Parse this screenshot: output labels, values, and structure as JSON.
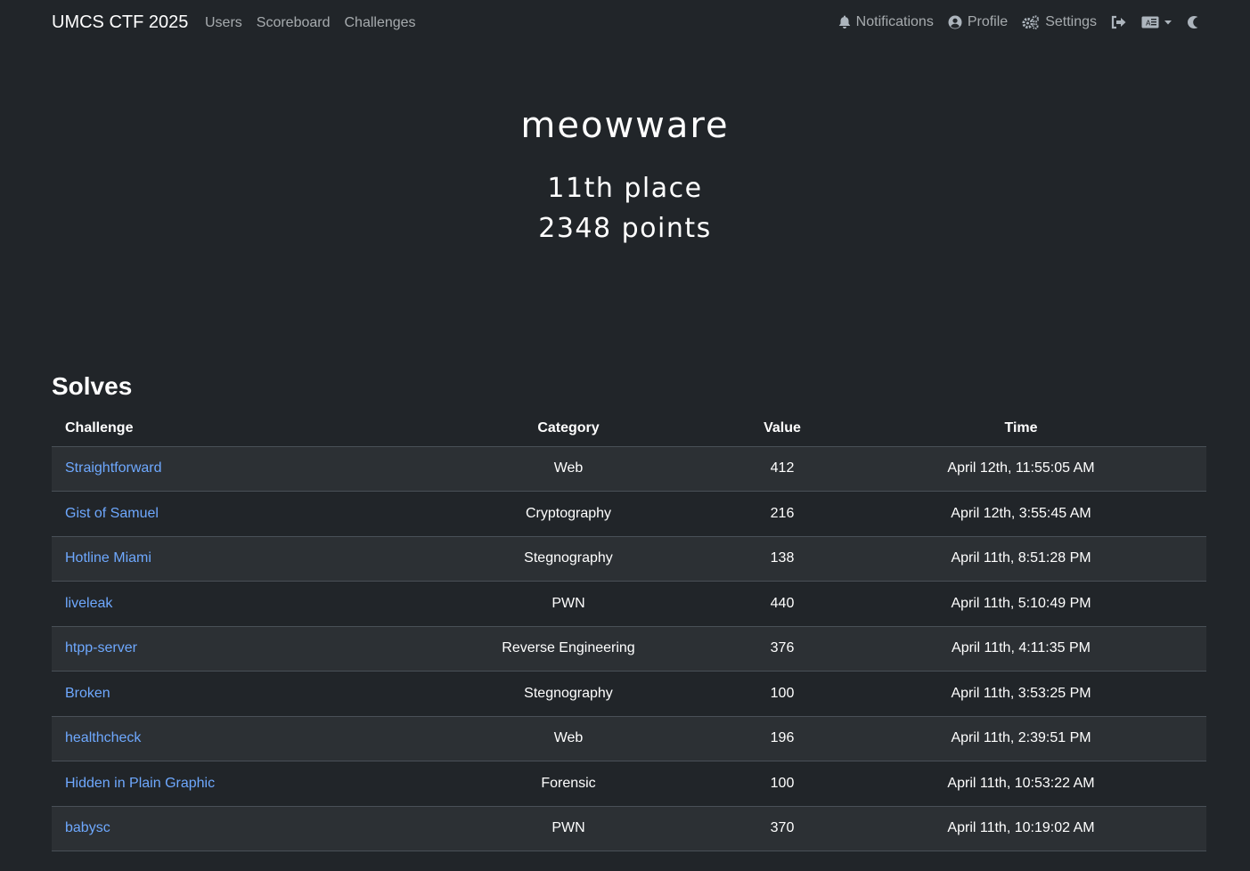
{
  "nav": {
    "brand": "UMCS CTF 2025",
    "links": [
      "Users",
      "Scoreboard",
      "Challenges"
    ],
    "notifications": "Notifications",
    "profile": "Profile",
    "settings": "Settings"
  },
  "hero": {
    "team_name": "meowware",
    "place": "11th place",
    "points": "2348 points"
  },
  "solves": {
    "title": "Solves",
    "headers": [
      "Challenge",
      "Category",
      "Value",
      "Time"
    ],
    "rows": [
      {
        "challenge": "Straightforward",
        "category": "Web",
        "value": "412",
        "time": "April 12th, 11:55:05 AM"
      },
      {
        "challenge": "Gist of Samuel",
        "category": "Cryptography",
        "value": "216",
        "time": "April 12th, 3:55:45 AM"
      },
      {
        "challenge": "Hotline Miami",
        "category": "Stegnography",
        "value": "138",
        "time": "April 11th, 8:51:28 PM"
      },
      {
        "challenge": "liveleak",
        "category": "PWN",
        "value": "440",
        "time": "April 11th, 5:10:49 PM"
      },
      {
        "challenge": "htpp-server",
        "category": "Reverse Engineering",
        "value": "376",
        "time": "April 11th, 4:11:35 PM"
      },
      {
        "challenge": "Broken",
        "category": "Stegnography",
        "value": "100",
        "time": "April 11th, 3:53:25 PM"
      },
      {
        "challenge": "healthcheck",
        "category": "Web",
        "value": "196",
        "time": "April 11th, 2:39:51 PM"
      },
      {
        "challenge": "Hidden in Plain Graphic",
        "category": "Forensic",
        "value": "100",
        "time": "April 11th, 10:53:22 AM"
      },
      {
        "challenge": "babysc",
        "category": "PWN",
        "value": "370",
        "time": "April 11th, 10:19:02 AM"
      }
    ]
  },
  "icons": {
    "notifications": "bell-icon",
    "profile": "user-circle-icon",
    "settings": "cogs-icon",
    "logout": "sign-out-icon",
    "language": "language-icon",
    "theme": "moon-icon"
  },
  "colors": {
    "background": "#212529",
    "link": "#6ea8fe",
    "striped_row": "#2c3034"
  }
}
